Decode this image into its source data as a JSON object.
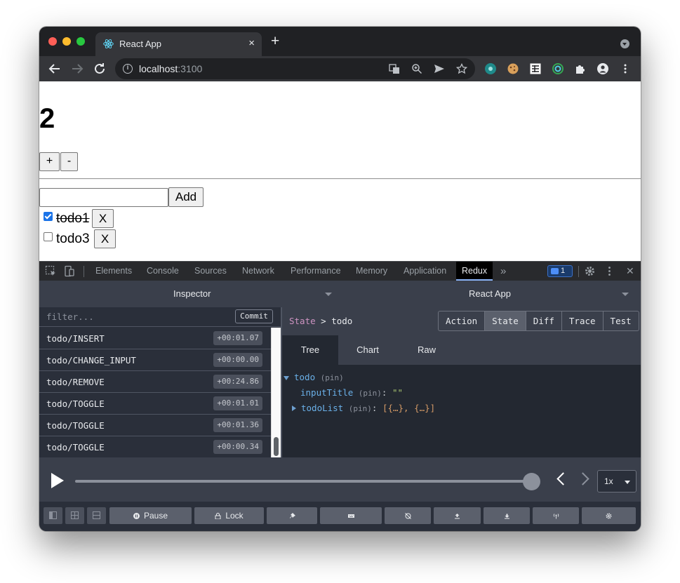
{
  "browser": {
    "tab_title": "React App",
    "tab_close": "×",
    "new_tab": "+",
    "url_host": "localhost",
    "url_port": ":3100"
  },
  "page": {
    "counter": "2",
    "increment_label": "+",
    "decrement_label": "-",
    "input_value": "",
    "add_label": "Add",
    "todos": [
      {
        "text": "todo1",
        "done": true,
        "remove_label": "X"
      },
      {
        "text": "todo3",
        "done": false,
        "remove_label": "X"
      }
    ]
  },
  "devtools": {
    "tabs": [
      "Elements",
      "Console",
      "Sources",
      "Network",
      "Performance",
      "Memory",
      "Application",
      "Redux"
    ],
    "active_tab": "Redux",
    "more": "»",
    "issues_count": "1",
    "close": "✕"
  },
  "redux": {
    "monitor": "Inspector",
    "instance": "React App",
    "filter_placeholder": "filter...",
    "commit_label": "Commit",
    "actions": [
      {
        "name": "todo/INSERT",
        "time": "+00:01.07"
      },
      {
        "name": "todo/CHANGE_INPUT",
        "time": "+00:00.00"
      },
      {
        "name": "todo/REMOVE",
        "time": "+00:24.86"
      },
      {
        "name": "todo/TOGGLE",
        "time": "+00:01.01"
      },
      {
        "name": "todo/TOGGLE",
        "time": "+00:01.36"
      },
      {
        "name": "todo/TOGGLE",
        "time": "+00:00.34"
      }
    ],
    "breadcrumb_root": "State",
    "breadcrumb_sep": " > ",
    "breadcrumb_leaf": "todo",
    "view_tabs": [
      "Action",
      "State",
      "Diff",
      "Trace",
      "Test"
    ],
    "active_view_tab": "State",
    "sub_tabs": [
      "Tree",
      "Chart",
      "Raw"
    ],
    "active_sub_tab": "Tree",
    "tree": {
      "root_key": "todo",
      "pin": "(pin)",
      "input_key": "inputTitle",
      "input_value": "\"\"",
      "list_key": "todoList",
      "list_value": "[{…}, {…}]",
      "colon": ":"
    },
    "slider_position": 1.0,
    "speed": "1x",
    "buttons": {
      "pause": "Pause",
      "lock": "Lock"
    }
  }
}
